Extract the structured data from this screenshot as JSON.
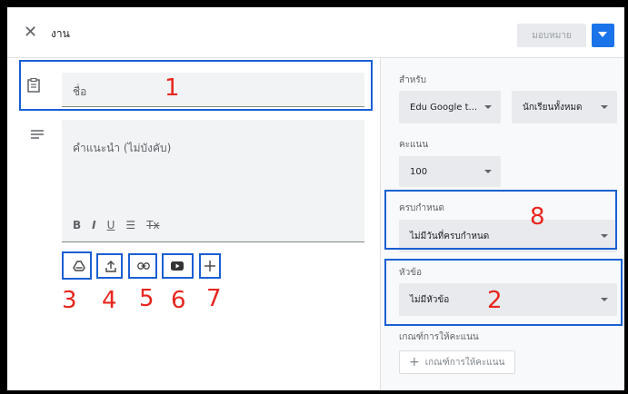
{
  "header": {
    "close_icon": "close-icon",
    "title": "งาน",
    "assign_label": "มอบหมาย",
    "dropdown_icon": "chevron-down-icon"
  },
  "main": {
    "title_placeholder": "ชื่อ",
    "desc_placeholder": "คำแนะนำ (ไม่บังคับ)",
    "formatting": [
      "B",
      "I",
      "U",
      "☰",
      "Tx"
    ],
    "attach_icons": [
      "drive-icon",
      "upload-icon",
      "link-icon",
      "youtube-icon",
      "plus-icon"
    ]
  },
  "side": {
    "for_label": "สำหรับ",
    "class_value": "Edu Google t...",
    "students_value": "นักเรียนทั้งหมด",
    "points_label": "คะแนน",
    "points_value": "100",
    "due_label": "ครบกำหนด",
    "due_value": "ไม่มีวันที่ครบกำหนด",
    "topic_label": "หัวข้อ",
    "topic_value": "ไม่มีหัวข้อ",
    "rubric_label": "เกณฑ์การให้คะแนน",
    "rubric_button": "เกณฑ์การให้คะแนน"
  },
  "annotations": [
    "1",
    "2",
    "3",
    "4",
    "5",
    "6",
    "7",
    "8"
  ],
  "colors": {
    "annotation_box": "#1a5fd3",
    "annotation_number": "#e8261e",
    "accent": "#1a73e8"
  }
}
